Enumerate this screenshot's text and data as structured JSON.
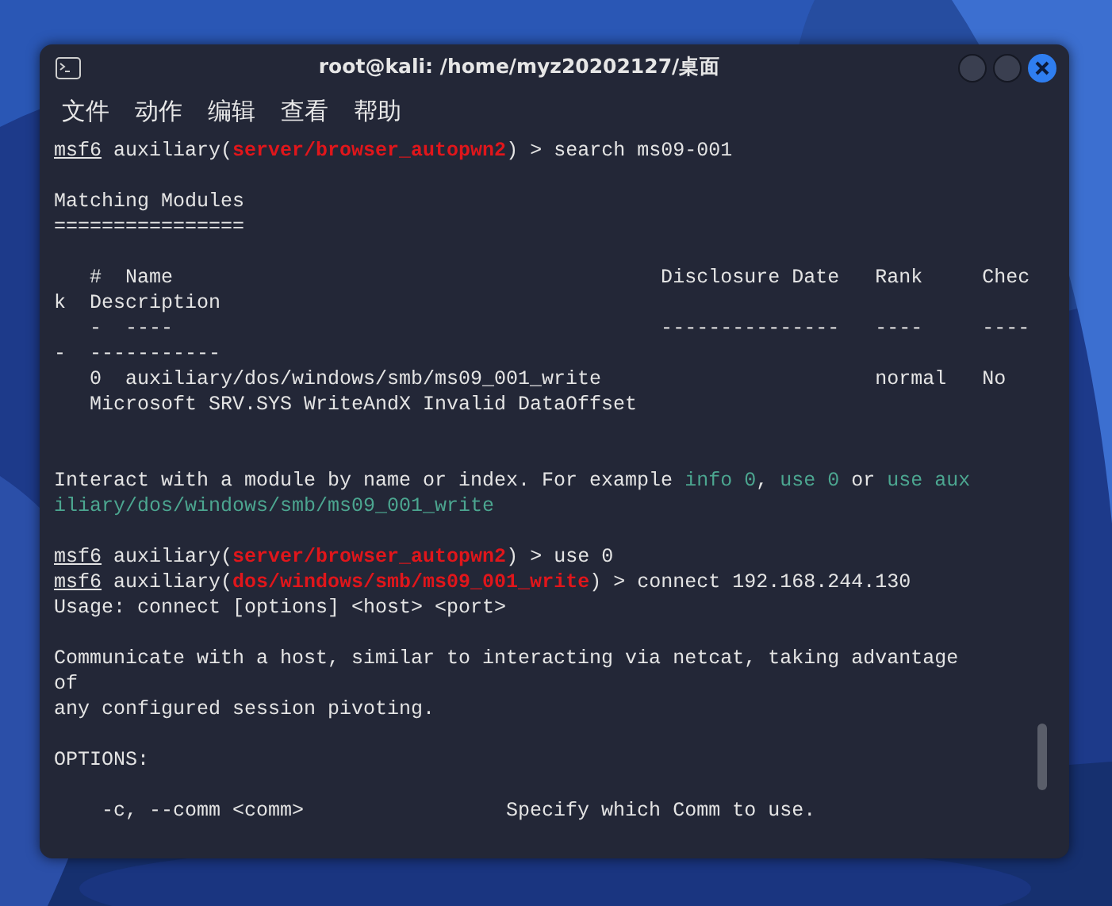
{
  "window": {
    "title": "root@kali: /home/myz20202127/桌面"
  },
  "menu": [
    "文件",
    "动作",
    "编辑",
    "查看",
    "帮助"
  ],
  "terminal": {
    "lines": [
      {
        "kind": "text",
        "segments": [
          {
            "kind": "prompt",
            "text": "msf6"
          },
          {
            "kind": "plain",
            "text": " auxiliary("
          },
          {
            "kind": "module",
            "text": "server/browser_autopwn2"
          },
          {
            "kind": "plain",
            "text": ") > search ms09-001"
          }
        ]
      },
      {
        "kind": "blank"
      },
      {
        "kind": "text",
        "segments": [
          {
            "kind": "plain",
            "text": "Matching Modules"
          }
        ]
      },
      {
        "kind": "text",
        "segments": [
          {
            "kind": "plain",
            "text": "================"
          }
        ]
      },
      {
        "kind": "blank"
      },
      {
        "kind": "text",
        "segments": [
          {
            "kind": "plain",
            "text": "   #  Name                                         Disclosure Date   Rank     Chec"
          }
        ]
      },
      {
        "kind": "text",
        "segments": [
          {
            "kind": "plain",
            "text": "k  Description"
          }
        ]
      },
      {
        "kind": "text",
        "segments": [
          {
            "kind": "plain",
            "text": "   -  ----                                         ---------------   ----     ----"
          }
        ]
      },
      {
        "kind": "text",
        "segments": [
          {
            "kind": "plain",
            "text": "-  -----------"
          }
        ]
      },
      {
        "kind": "text",
        "segments": [
          {
            "kind": "plain",
            "text": "   0  auxiliary/dos/windows/smb/ms09_001_write                       normal   No"
          }
        ]
      },
      {
        "kind": "text",
        "segments": [
          {
            "kind": "plain",
            "text": "   Microsoft SRV.SYS WriteAndX Invalid DataOffset"
          }
        ]
      },
      {
        "kind": "blank"
      },
      {
        "kind": "blank"
      },
      {
        "kind": "text",
        "segments": [
          {
            "kind": "plain",
            "text": "Interact with a module by name or index. For example "
          },
          {
            "kind": "hint",
            "text": "info 0"
          },
          {
            "kind": "plain",
            "text": ", "
          },
          {
            "kind": "hint",
            "text": "use 0"
          },
          {
            "kind": "plain",
            "text": " or "
          },
          {
            "kind": "hint",
            "text": "use aux"
          }
        ]
      },
      {
        "kind": "text",
        "segments": [
          {
            "kind": "hint",
            "text": "iliary/dos/windows/smb/ms09_001_write"
          }
        ]
      },
      {
        "kind": "blank"
      },
      {
        "kind": "text",
        "segments": [
          {
            "kind": "prompt",
            "text": "msf6"
          },
          {
            "kind": "plain",
            "text": " auxiliary("
          },
          {
            "kind": "module",
            "text": "server/browser_autopwn2"
          },
          {
            "kind": "plain",
            "text": ") > use 0"
          }
        ]
      },
      {
        "kind": "text",
        "segments": [
          {
            "kind": "prompt",
            "text": "msf6"
          },
          {
            "kind": "plain",
            "text": " auxiliary("
          },
          {
            "kind": "module",
            "text": "dos/windows/smb/ms09_001_write"
          },
          {
            "kind": "plain",
            "text": ") > connect 192.168.244.130"
          }
        ]
      },
      {
        "kind": "text",
        "segments": [
          {
            "kind": "plain",
            "text": "Usage: connect [options] <host> <port>"
          }
        ]
      },
      {
        "kind": "blank"
      },
      {
        "kind": "text",
        "segments": [
          {
            "kind": "plain",
            "text": "Communicate with a host, similar to interacting via netcat, taking advantage"
          }
        ]
      },
      {
        "kind": "text",
        "segments": [
          {
            "kind": "plain",
            "text": "of"
          }
        ]
      },
      {
        "kind": "text",
        "segments": [
          {
            "kind": "plain",
            "text": "any configured session pivoting."
          }
        ]
      },
      {
        "kind": "blank"
      },
      {
        "kind": "text",
        "segments": [
          {
            "kind": "plain",
            "text": "OPTIONS:"
          }
        ]
      },
      {
        "kind": "blank"
      },
      {
        "kind": "text",
        "segments": [
          {
            "kind": "plain",
            "text": "    -c, --comm <comm>                 Specify which Comm to use."
          }
        ]
      }
    ]
  }
}
